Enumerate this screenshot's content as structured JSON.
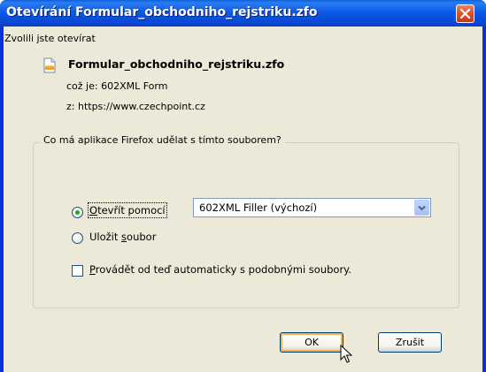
{
  "window": {
    "title": "Otevírání Formular_obchodniho_rejstriku.zfo"
  },
  "dialog": {
    "intro": "Zvolili jste otevírat",
    "filename": "Formular_obchodniho_rejstriku.zfo",
    "type_line": "což je:  602XML Form",
    "source_line": "z:  https://www.czechpoint.cz",
    "group_title": "Co má aplikace Firefox udělat s tímto souborem?",
    "open_with": {
      "label_access": "O",
      "label_rest": "tevřít pomocí",
      "selected": true,
      "app_value": "602XML Filler (výchozí)"
    },
    "save_file": {
      "label_pre": "Uložit ",
      "label_access": "s",
      "label_rest": "oubor",
      "selected": false
    },
    "auto_checkbox": {
      "label_access": "P",
      "label_rest": "rovádět od teď automaticky s podobnými soubory.",
      "checked": false
    }
  },
  "buttons": {
    "ok": "OK",
    "cancel": "Zrušit"
  },
  "icons": {
    "file": "document-icon",
    "close": "close-icon",
    "dropdown": "chevron-down-icon",
    "cursor": "mouse-pointer-icon"
  },
  "colors": {
    "titlebar": "#0845d1",
    "face": "#ece9d8",
    "close": "#d9552f",
    "radio_dot": "#21a121",
    "default_button_glow": "#f8b049"
  }
}
